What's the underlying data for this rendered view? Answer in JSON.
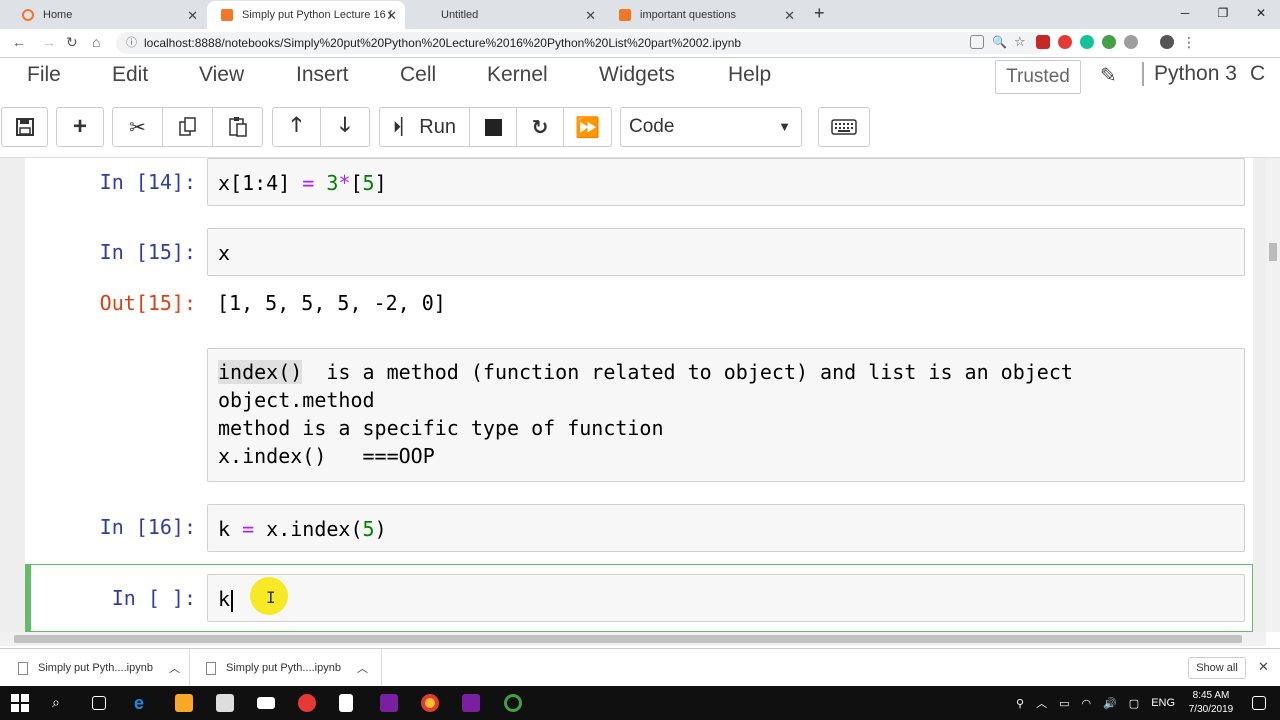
{
  "browser": {
    "tabs": [
      {
        "title": "Home",
        "active": false
      },
      {
        "title": "Simply put Python Lecture 16 Py",
        "active": true
      },
      {
        "title": "Untitled",
        "active": false
      },
      {
        "title": "important questions",
        "active": false
      }
    ],
    "url": "localhost:8888/notebooks/Simply%20put%20Python%20Lecture%2016%20Python%20List%20part%2002.ipynb"
  },
  "menubar": {
    "items": [
      "File",
      "Edit",
      "View",
      "Insert",
      "Cell",
      "Kernel",
      "Widgets",
      "Help"
    ],
    "trusted": "Trusted",
    "kernel": "Python 3"
  },
  "toolbar": {
    "run_label": "Run",
    "cell_type": "Code"
  },
  "cells": {
    "c14": {
      "prompt": "In [14]:",
      "code_parts": [
        "x[1:4] ",
        "=",
        " ",
        "3",
        "*",
        "[",
        "5",
        "]"
      ]
    },
    "c15": {
      "prompt": "In [15]:",
      "code": "x",
      "out_prompt": "Out[15]:",
      "output": "[1, 5, 5, 5, -2, 0]"
    },
    "md": {
      "line1_hl": "index()",
      "line1_rest": "  is a method (function related to object) and list is an object",
      "line2": "object.method",
      "line3": "method is a specific type of function",
      "line4": "x.index()   ===OOP"
    },
    "c16": {
      "prompt": "In [16]:",
      "code_var": "k ",
      "code_eq": "=",
      "code_rest": " x.index(",
      "code_num": "5",
      "code_close": ")"
    },
    "c_new": {
      "prompt": "In [ ]:",
      "code": "k"
    }
  },
  "downloads": [
    {
      "name": "Simply put Pyth....ipynb"
    },
    {
      "name": "Simply put Pyth....ipynb"
    }
  ],
  "downloads_show_all": "Show all",
  "taskbar": {
    "lang": "ENG",
    "time": "8:45 AM",
    "date": "7/30/2019"
  }
}
